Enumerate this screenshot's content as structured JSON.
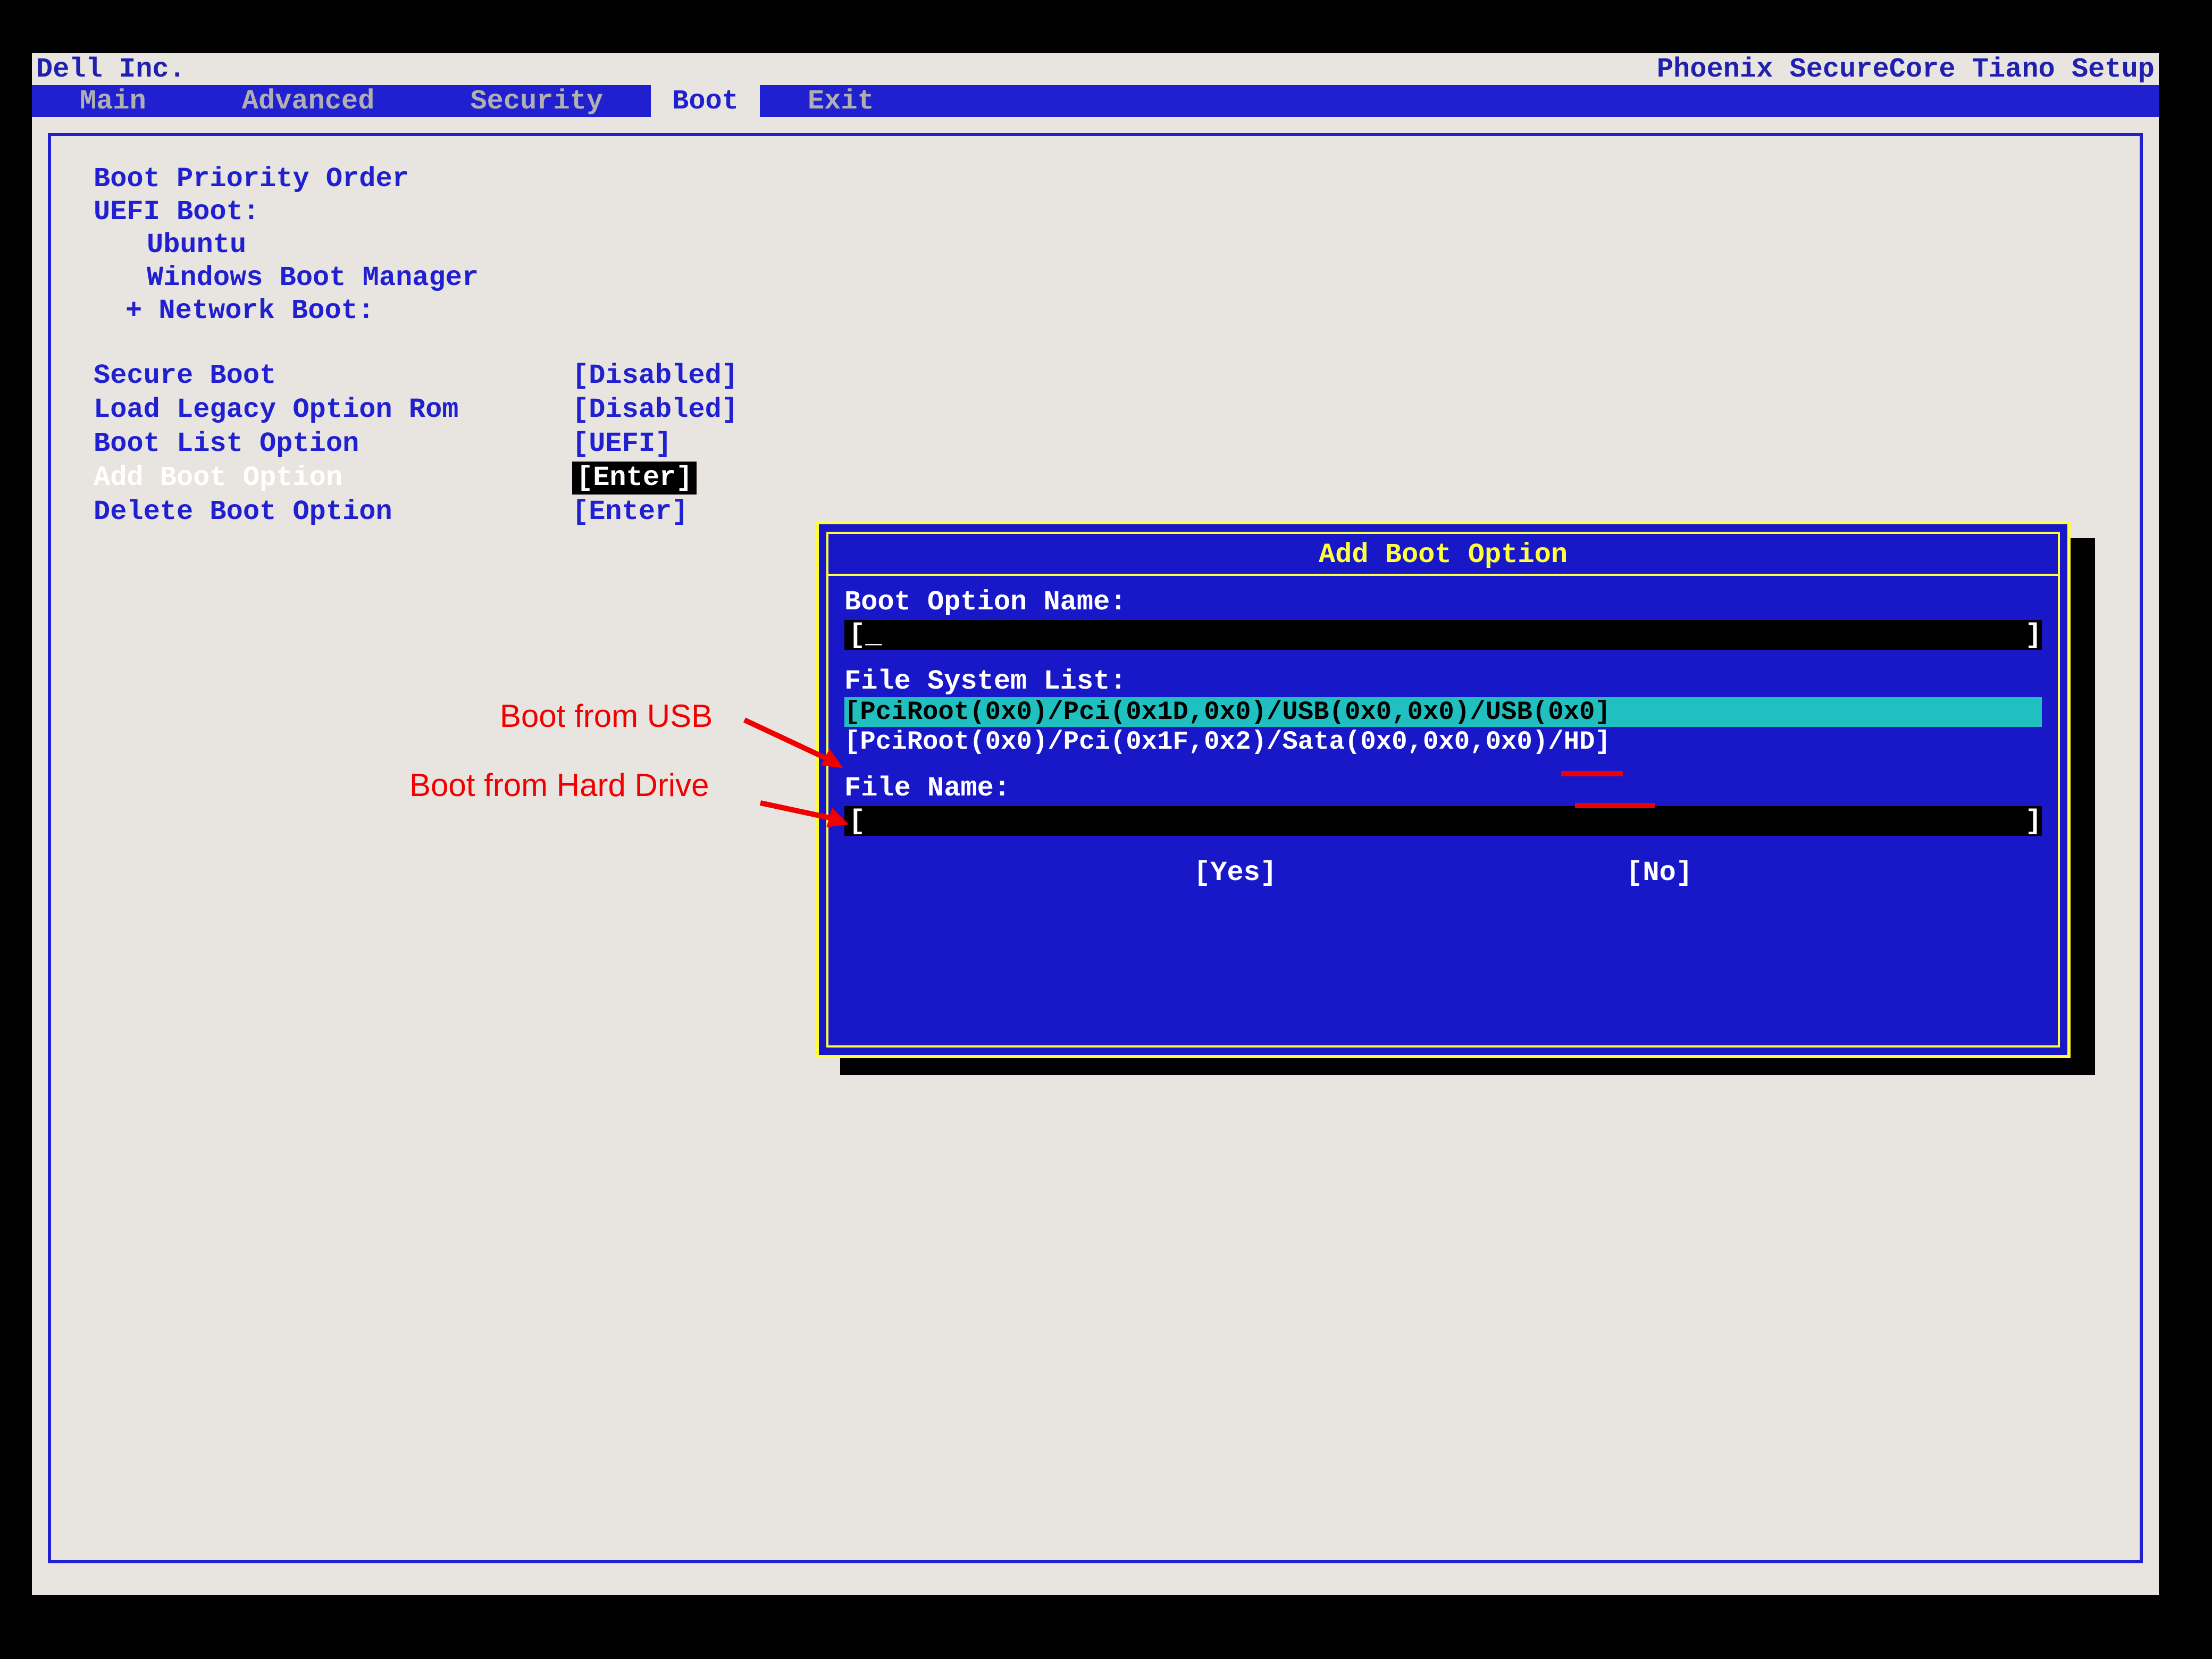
{
  "header": {
    "vendor": "Dell Inc.",
    "title": "Phoenix SecureCore Tiano Setup"
  },
  "menubar": {
    "items": [
      "Main",
      "Advanced",
      "Security",
      "Boot",
      "Exit"
    ],
    "active": "Boot"
  },
  "boot_page": {
    "priority_heading": "Boot Priority Order",
    "uefi_heading": "UEFI Boot:",
    "uefi_items": [
      "Ubuntu",
      "Windows Boot Manager"
    ],
    "network_heading": "+ Network Boot:",
    "settings": [
      {
        "label": "Secure Boot",
        "value": "[Disabled]"
      },
      {
        "label": "Load Legacy Option Rom",
        "value": "[Disabled]"
      },
      {
        "label": "Boot List Option",
        "value": "[UEFI]"
      },
      {
        "label": "Add Boot Option",
        "value": "[Enter]",
        "selected": true
      },
      {
        "label": "Delete Boot Option",
        "value": "[Enter]"
      }
    ]
  },
  "dialog": {
    "title": "Add Boot Option",
    "name_label": "Boot Option Name:",
    "name_value": "[_",
    "name_right": "]",
    "fs_label": "File System List:",
    "fs_items": [
      "[PciRoot(0x0)/Pci(0x1D,0x0)/USB(0x0,0x0)/USB(0x0]",
      "[PciRoot(0x0)/Pci(0x1F,0x2)/Sata(0x0,0x0,0x0)/HD]"
    ],
    "filename_label": "File Name:",
    "filename_value": "[",
    "filename_right": "]",
    "yes": "[Yes]",
    "no": "[No]"
  },
  "annotations": {
    "usb": "Boot from USB",
    "hdd": "Boot from Hard Drive"
  }
}
